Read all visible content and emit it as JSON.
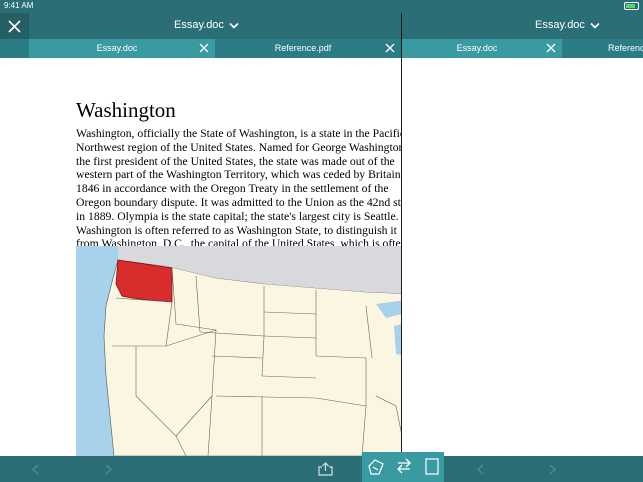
{
  "status_bar": {
    "time": "9:41 AM"
  },
  "left_pane": {
    "title": "Essay.doc",
    "tabs": [
      {
        "label": "Essay.doc",
        "active": true
      },
      {
        "label": "Reference.pdf",
        "active": false
      }
    ],
    "document": {
      "heading": "Washington",
      "body": "Washington, officially the State of Washington, is a state in the Pacific Northwest region of the United States. Named for George Washington, the first president of the United States, the state was made out of the western part of the Washington Territory, which was ceded by Britain in 1846 in accordance with the Oregon Treaty in the settlement of the Oregon boundary dispute. It was admitted to the Union as the 42nd state in 1889. Olympia is the state capital; the state's largest city is Seattle. Washington is often referred to as Washington State, to distinguish it from Washington, D.C., the capital of the United States, which is often shortened to Washington or just D.C."
    }
  },
  "right_pane": {
    "title": "Essay.doc",
    "tabs": [
      {
        "label": "Essay.doc",
        "active": true
      },
      {
        "label": "Reference.pdf",
        "active": false
      }
    ]
  },
  "icons": {
    "close": "close-icon",
    "chevron": "chevron-down-icon",
    "back": "back-arrow-icon",
    "forward": "forward-arrow-icon",
    "share": "share-icon",
    "annotate": "annotate-icon",
    "swap": "swap-icon",
    "page": "page-icon"
  },
  "colors": {
    "toolbar": "#2b6e76",
    "tab_strip": "#2b7c84",
    "active_tab": "#3a9aa2",
    "highlight_state": "#d92d2d"
  }
}
